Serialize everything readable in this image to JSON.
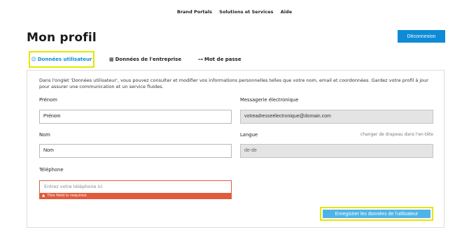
{
  "topnav": {
    "items": [
      "Brand Portals",
      "Solutions et Services",
      "Aide"
    ]
  },
  "page": {
    "title": "Mon profil",
    "logout_label": "Déconnexion"
  },
  "tabs": [
    {
      "label": "Données utilisateur",
      "icon": "user-icon",
      "active": true
    },
    {
      "label": "Données de l'entreprise",
      "icon": "building-icon",
      "active": false
    },
    {
      "label": "Mot de passe",
      "icon": "key-icon",
      "active": false
    }
  ],
  "intro_text": "Dans l'onglet 'Données utilisateur', vous pouvez consulter et modifier vos informations personnelles telles que votre nom, email et coordonnées. Gardez votre profil à jour pour assurer une communication et un service fluides.",
  "form": {
    "first_name": {
      "label": "Prénom",
      "value": "Prénom"
    },
    "email": {
      "label": "Messagerie électronique",
      "value": "votreadresseélectronique@domain.com"
    },
    "last_name": {
      "label": "Nom",
      "value": "Nom"
    },
    "language": {
      "label": "Langue",
      "value": "de-de",
      "hint": "changer de drapeau dans l'en-tête"
    },
    "phone": {
      "label": "Téléphone",
      "value": "",
      "placeholder": "Entrez votre téléphone ici",
      "error": "This field is required."
    }
  },
  "save_label": "Enregistrer les données de l'utilisateur",
  "colors": {
    "accent": "#0d8bd6",
    "save_button": "#4eb3e8",
    "highlight": "#e6e600",
    "error": "#e05b3d"
  }
}
